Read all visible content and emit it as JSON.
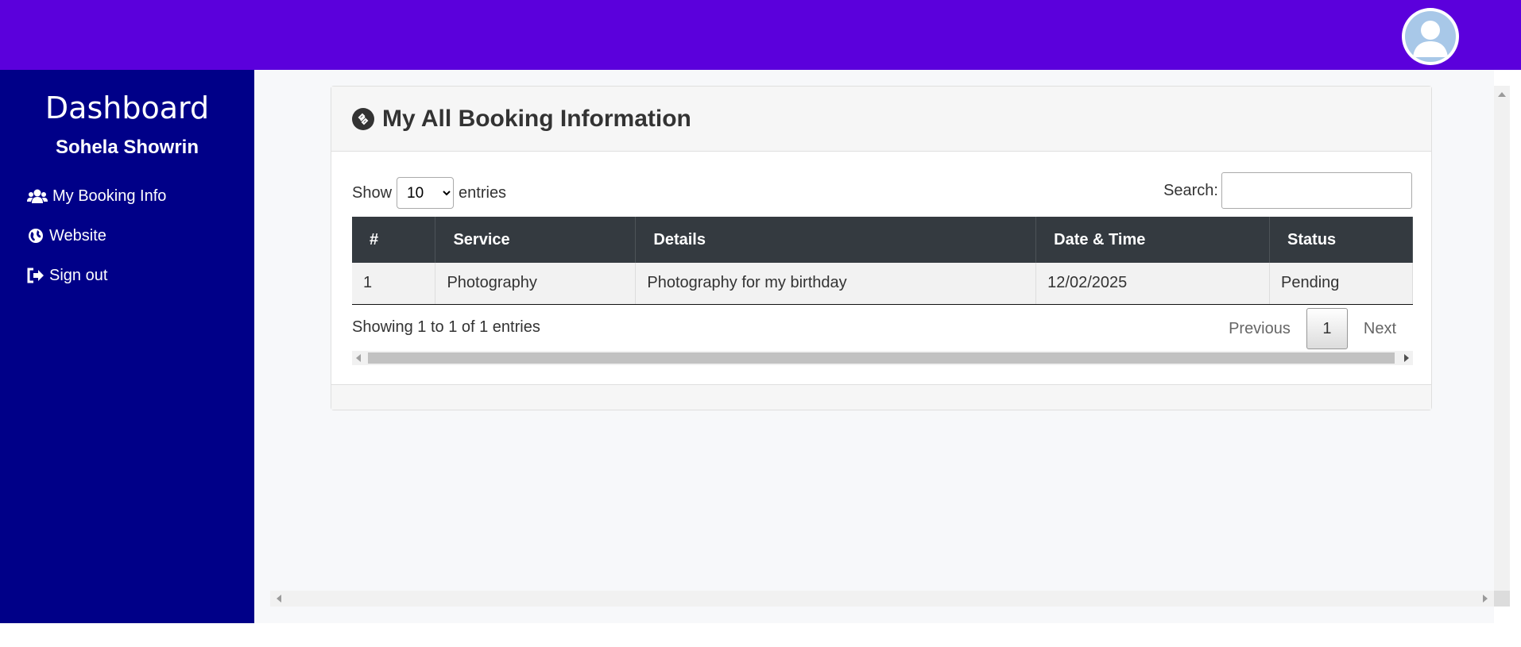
{
  "sidebar": {
    "title": "Dashboard",
    "user": "Sohela Showrin",
    "items": [
      {
        "label": "My Booking Info",
        "icon": "users-icon"
      },
      {
        "label": "Website",
        "icon": "globe-icon"
      },
      {
        "label": "Sign out",
        "icon": "sign-out-icon"
      }
    ]
  },
  "card": {
    "title": "My All Booking Information",
    "icon": "connection-icon"
  },
  "table_controls": {
    "show_label": "Show",
    "entries_label": "entries",
    "page_size": "10",
    "search_label": "Search:"
  },
  "table": {
    "headers": [
      "#",
      "Service",
      "Details",
      "Date & Time",
      "Status"
    ],
    "rows": [
      [
        "1",
        "Photography",
        "Photography for my birthday",
        "12/02/2025",
        "Pending"
      ]
    ]
  },
  "footer": {
    "info": "Showing 1 to 1 of 1 entries",
    "previous": "Previous",
    "current_page": "1",
    "next": "Next"
  },
  "colors": {
    "topbar": "#5b00dc",
    "sidebar": "#000088",
    "table_header": "#343a40"
  }
}
